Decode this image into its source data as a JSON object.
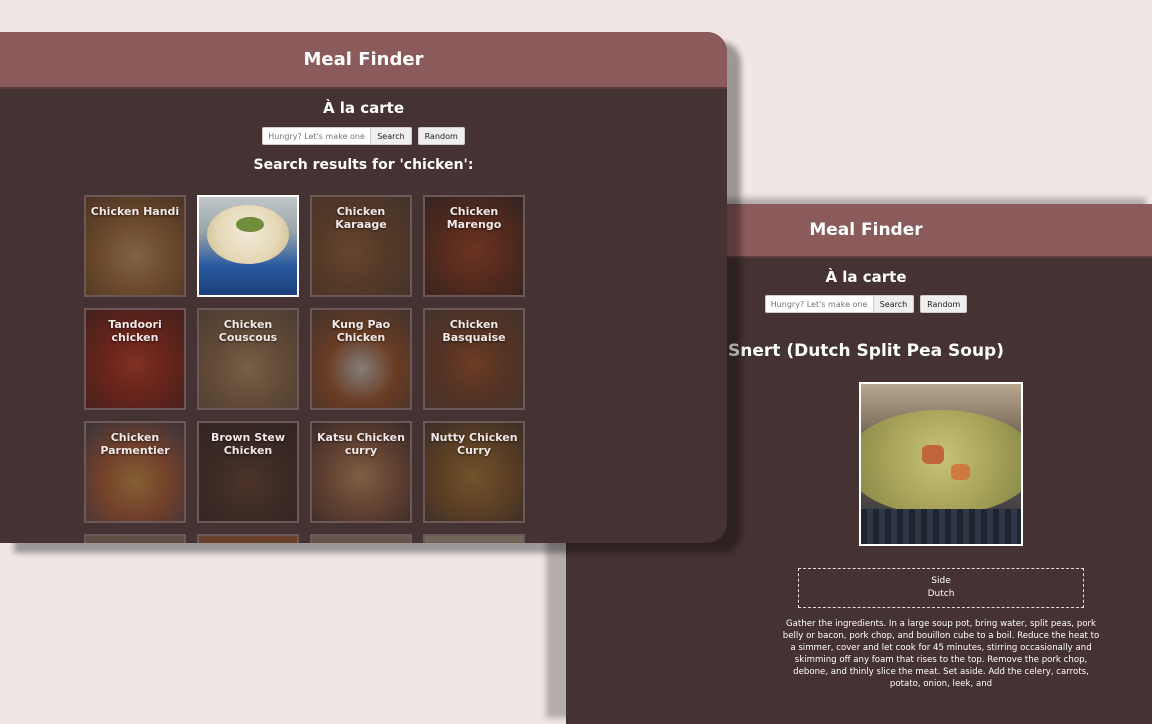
{
  "left_window": {
    "title": "Meal Finder",
    "subtitle": "À la carte",
    "search": {
      "placeholder": "Hungry? Let's make one",
      "button": "Search"
    },
    "random_button": "Random",
    "results_heading": "Search results for 'chicken':",
    "meals": [
      {
        "name": "Chicken Handi"
      },
      {
        "name": ""
      },
      {
        "name": "Chicken Karaage"
      },
      {
        "name": "Chicken Marengo"
      },
      {
        "name": "Tandoori chicken"
      },
      {
        "name": "Chicken Couscous"
      },
      {
        "name": "Kung Pao Chicken"
      },
      {
        "name": "Chicken Basquaise"
      },
      {
        "name": "Chicken Parmentier"
      },
      {
        "name": "Brown Stew Chicken"
      },
      {
        "name": "Katsu Chicken curry"
      },
      {
        "name": "Nutty Chicken Curry"
      },
      {
        "name": ""
      },
      {
        "name": ""
      },
      {
        "name": ""
      },
      {
        "name": ""
      }
    ]
  },
  "right_window": {
    "title": "Meal Finder",
    "subtitle": "À la carte",
    "search": {
      "placeholder": "Hungry? Let's make one",
      "button": "Search"
    },
    "random_button": "Random",
    "meal_title": "Snert (Dutch Split Pea Soup)",
    "category": "Side",
    "area": "Dutch",
    "instructions": "Gather the ingredients. In a large soup pot, bring water, split peas, pork belly or bacon, pork chop, and bouillon cube to a boil. Reduce the heat to a simmer, cover and let cook for 45 minutes, stirring occasionally and skimming off any foam that rises to the top. Remove the pork chop, debone, and thinly slice the meat. Set aside. Add the celery, carrots, potato, onion, leek, and"
  },
  "colors": {
    "page_background": "#f0e6e6",
    "window_background": "#453232",
    "header_background": "#8b5a5a",
    "text": "#ffffff"
  }
}
